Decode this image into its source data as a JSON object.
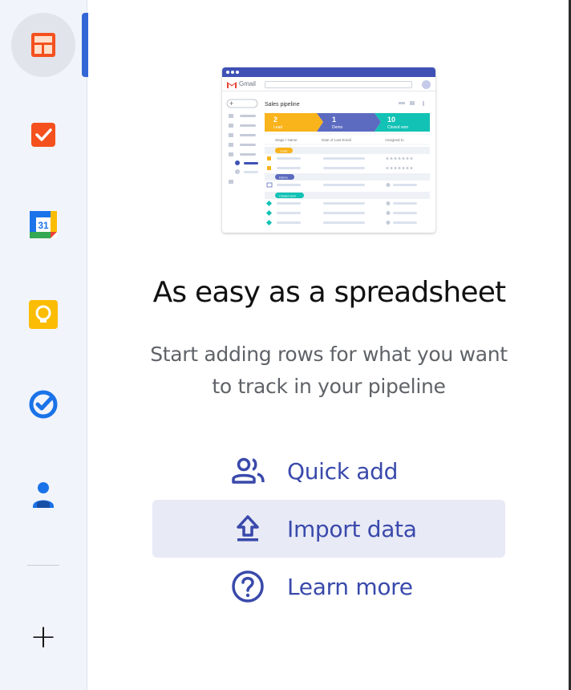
{
  "rail": {
    "items": [
      {
        "name": "layout-icon",
        "color": "#f4511e"
      },
      {
        "name": "tasks-check-icon",
        "color": "#f4511e"
      },
      {
        "name": "calendar-icon",
        "label": "31"
      },
      {
        "name": "keep-bulb-icon",
        "color": "#fbbc04"
      },
      {
        "name": "tasks-icon",
        "color": "#1a73e8"
      },
      {
        "name": "contacts-icon",
        "color": "#1a73e8"
      }
    ],
    "add_symbol": "+"
  },
  "illustration": {
    "app_name": "Gmail",
    "sheet_title": "Sales pipeline",
    "stages": [
      {
        "count": "2",
        "label": "Lead",
        "color": "#f9b31b"
      },
      {
        "count": "1",
        "label": "Demo",
        "color": "#5c6bc0"
      },
      {
        "count": "10",
        "label": "Closed won",
        "color": "#12c2b4"
      }
    ],
    "columns": [
      "Stage / Name",
      "Date of Last Email",
      "Assigned to"
    ],
    "groups": [
      "Lead",
      "Demo",
      "Closed won"
    ]
  },
  "main": {
    "title": "As easy as a spreadsheet",
    "subtitle_line1": "Start adding rows for what you want",
    "subtitle_line2": "to track in your pipeline"
  },
  "actions": [
    {
      "label": "Quick add",
      "icon": "people-icon"
    },
    {
      "label": "Import data",
      "icon": "upload-icon"
    },
    {
      "label": "Learn more",
      "icon": "help-circle-icon"
    }
  ],
  "colors": {
    "accent": "#3949ab",
    "highlight": "#e8eaf6",
    "rail_bg": "#f1f4fb"
  }
}
